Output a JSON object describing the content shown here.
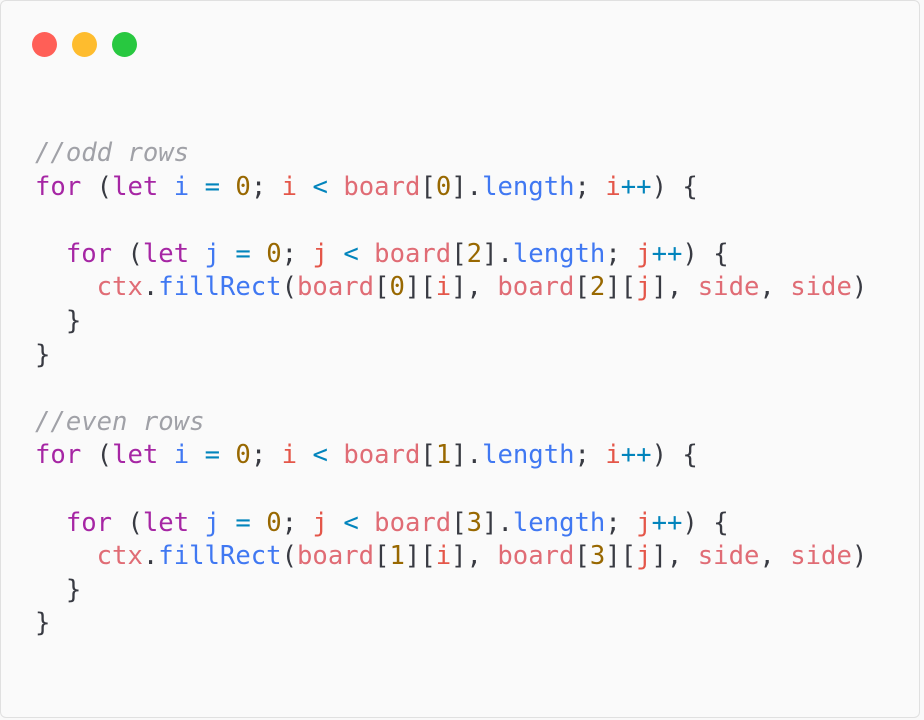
{
  "window": {
    "controls": [
      {
        "name": "close-dot",
        "color": "#ff5f57"
      },
      {
        "name": "minimize-dot",
        "color": "#febc2e"
      },
      {
        "name": "zoom-dot",
        "color": "#28c840"
      }
    ]
  },
  "code": {
    "lines": [
      [
        [
          "comment",
          "//odd rows"
        ]
      ],
      [
        [
          "keyword",
          "for"
        ],
        [
          "plain",
          " ("
        ],
        [
          "keyword",
          "let"
        ],
        [
          "plain",
          " "
        ],
        [
          "property",
          "i"
        ],
        [
          "plain",
          " "
        ],
        [
          "operator",
          "="
        ],
        [
          "plain",
          " "
        ],
        [
          "number",
          "0"
        ],
        [
          "plain",
          "; "
        ],
        [
          "variable",
          "i"
        ],
        [
          "plain",
          " "
        ],
        [
          "operator",
          "<"
        ],
        [
          "plain",
          " "
        ],
        [
          "identifier",
          "board"
        ],
        [
          "plain",
          "["
        ],
        [
          "number",
          "0"
        ],
        [
          "plain",
          "]."
        ],
        [
          "property",
          "length"
        ],
        [
          "plain",
          "; "
        ],
        [
          "variable",
          "i"
        ],
        [
          "operator",
          "++"
        ],
        [
          "plain",
          ") {"
        ]
      ],
      [],
      [
        [
          "plain",
          "  "
        ],
        [
          "keyword",
          "for"
        ],
        [
          "plain",
          " ("
        ],
        [
          "keyword",
          "let"
        ],
        [
          "plain",
          " "
        ],
        [
          "property",
          "j"
        ],
        [
          "plain",
          " "
        ],
        [
          "operator",
          "="
        ],
        [
          "plain",
          " "
        ],
        [
          "number",
          "0"
        ],
        [
          "plain",
          "; "
        ],
        [
          "variable",
          "j"
        ],
        [
          "plain",
          " "
        ],
        [
          "operator",
          "<"
        ],
        [
          "plain",
          " "
        ],
        [
          "identifier",
          "board"
        ],
        [
          "plain",
          "["
        ],
        [
          "number",
          "2"
        ],
        [
          "plain",
          "]."
        ],
        [
          "property",
          "length"
        ],
        [
          "plain",
          "; "
        ],
        [
          "variable",
          "j"
        ],
        [
          "operator",
          "++"
        ],
        [
          "plain",
          ") {"
        ]
      ],
      [
        [
          "plain",
          "    "
        ],
        [
          "identifier",
          "ctx"
        ],
        [
          "plain",
          "."
        ],
        [
          "function",
          "fillRect"
        ],
        [
          "plain",
          "("
        ],
        [
          "identifier",
          "board"
        ],
        [
          "plain",
          "["
        ],
        [
          "number",
          "0"
        ],
        [
          "plain",
          "]["
        ],
        [
          "variable",
          "i"
        ],
        [
          "plain",
          "], "
        ],
        [
          "identifier",
          "board"
        ],
        [
          "plain",
          "["
        ],
        [
          "number",
          "2"
        ],
        [
          "plain",
          "]["
        ],
        [
          "variable",
          "j"
        ],
        [
          "plain",
          "], "
        ],
        [
          "identifier",
          "side"
        ],
        [
          "plain",
          ", "
        ],
        [
          "identifier",
          "side"
        ],
        [
          "plain",
          ")"
        ]
      ],
      [
        [
          "plain",
          "  }"
        ]
      ],
      [
        [
          "plain",
          "}"
        ]
      ],
      [],
      [
        [
          "comment",
          "//even rows"
        ]
      ],
      [
        [
          "keyword",
          "for"
        ],
        [
          "plain",
          " ("
        ],
        [
          "keyword",
          "let"
        ],
        [
          "plain",
          " "
        ],
        [
          "property",
          "i"
        ],
        [
          "plain",
          " "
        ],
        [
          "operator",
          "="
        ],
        [
          "plain",
          " "
        ],
        [
          "number",
          "0"
        ],
        [
          "plain",
          "; "
        ],
        [
          "variable",
          "i"
        ],
        [
          "plain",
          " "
        ],
        [
          "operator",
          "<"
        ],
        [
          "plain",
          " "
        ],
        [
          "identifier",
          "board"
        ],
        [
          "plain",
          "["
        ],
        [
          "number",
          "1"
        ],
        [
          "plain",
          "]."
        ],
        [
          "property",
          "length"
        ],
        [
          "plain",
          "; "
        ],
        [
          "variable",
          "i"
        ],
        [
          "operator",
          "++"
        ],
        [
          "plain",
          ") {"
        ]
      ],
      [],
      [
        [
          "plain",
          "  "
        ],
        [
          "keyword",
          "for"
        ],
        [
          "plain",
          " ("
        ],
        [
          "keyword",
          "let"
        ],
        [
          "plain",
          " "
        ],
        [
          "property",
          "j"
        ],
        [
          "plain",
          " "
        ],
        [
          "operator",
          "="
        ],
        [
          "plain",
          " "
        ],
        [
          "number",
          "0"
        ],
        [
          "plain",
          "; "
        ],
        [
          "variable",
          "j"
        ],
        [
          "plain",
          " "
        ],
        [
          "operator",
          "<"
        ],
        [
          "plain",
          " "
        ],
        [
          "identifier",
          "board"
        ],
        [
          "plain",
          "["
        ],
        [
          "number",
          "3"
        ],
        [
          "plain",
          "]."
        ],
        [
          "property",
          "length"
        ],
        [
          "plain",
          "; "
        ],
        [
          "variable",
          "j"
        ],
        [
          "operator",
          "++"
        ],
        [
          "plain",
          ") {"
        ]
      ],
      [
        [
          "plain",
          "    "
        ],
        [
          "identifier",
          "ctx"
        ],
        [
          "plain",
          "."
        ],
        [
          "function",
          "fillRect"
        ],
        [
          "plain",
          "("
        ],
        [
          "identifier",
          "board"
        ],
        [
          "plain",
          "["
        ],
        [
          "number",
          "1"
        ],
        [
          "plain",
          "]["
        ],
        [
          "variable",
          "i"
        ],
        [
          "plain",
          "], "
        ],
        [
          "identifier",
          "board"
        ],
        [
          "plain",
          "["
        ],
        [
          "number",
          "3"
        ],
        [
          "plain",
          "]["
        ],
        [
          "variable",
          "j"
        ],
        [
          "plain",
          "], "
        ],
        [
          "identifier",
          "side"
        ],
        [
          "plain",
          ", "
        ],
        [
          "identifier",
          "side"
        ],
        [
          "plain",
          ")"
        ]
      ],
      [
        [
          "plain",
          "  }"
        ]
      ],
      [
        [
          "plain",
          "}"
        ]
      ]
    ]
  }
}
